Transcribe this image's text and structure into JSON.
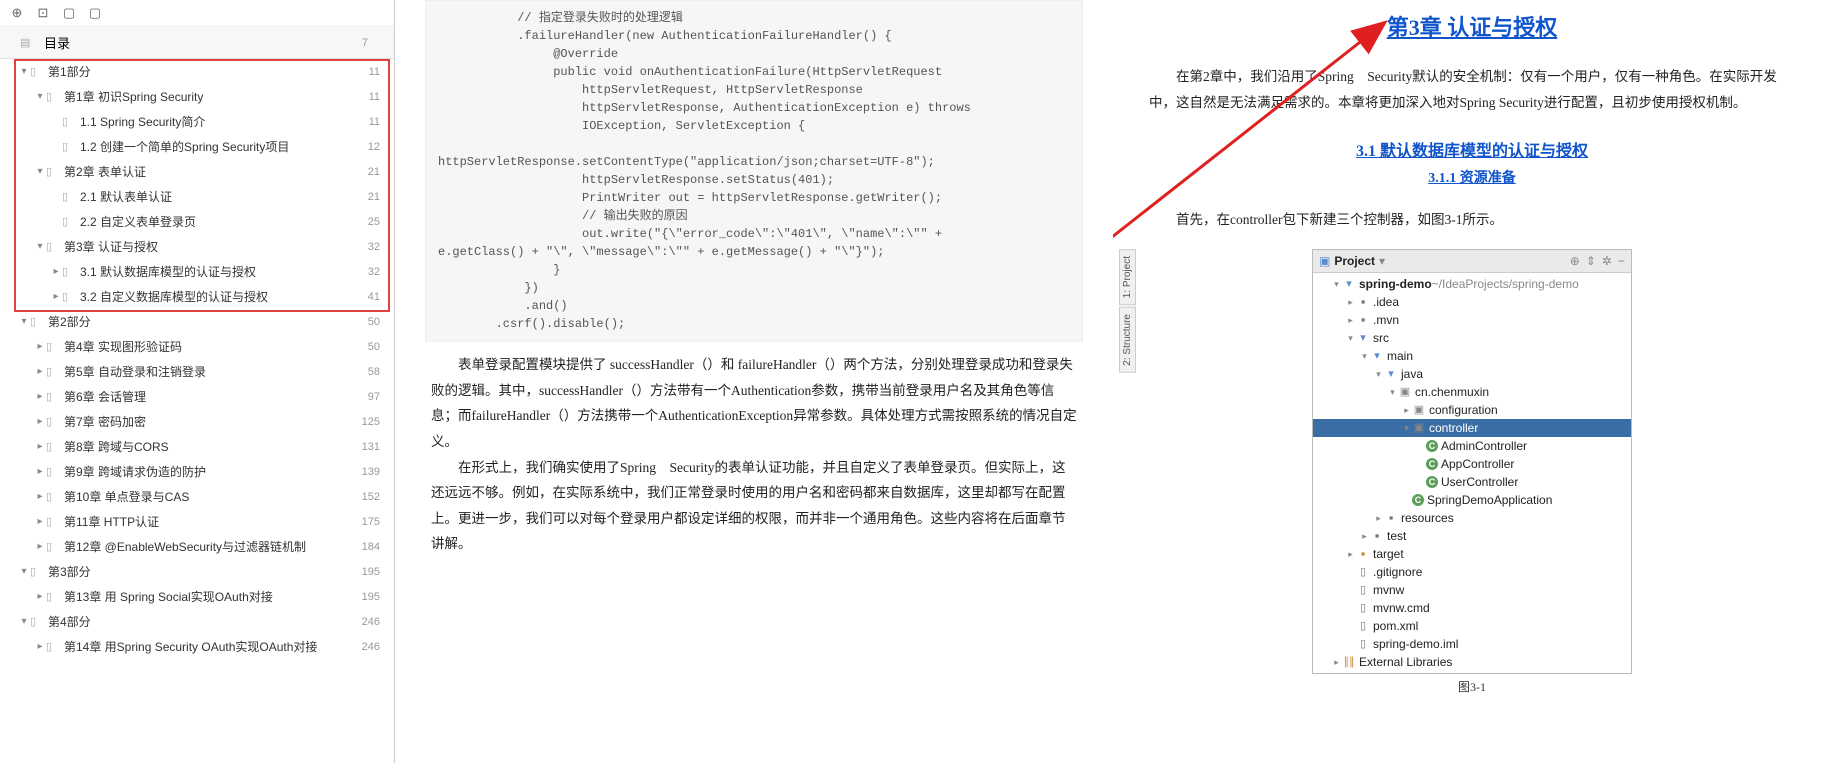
{
  "toolbar": {
    "btn1": "⊕",
    "btn2": "⊡",
    "btn3": "▢",
    "btn4": "▢"
  },
  "toc": {
    "header_label": "目录",
    "header_page": "7",
    "items": [
      {
        "level": 0,
        "exp": "▾",
        "label": "第1部分",
        "page": "11"
      },
      {
        "level": 1,
        "exp": "▾",
        "label": "第1章 初识Spring Security",
        "page": "11"
      },
      {
        "level": 2,
        "exp": "",
        "label": "1.1 Spring Security简介",
        "page": "11"
      },
      {
        "level": 2,
        "exp": "",
        "label": "1.2 创建一个简单的Spring Security项目",
        "page": "12"
      },
      {
        "level": 1,
        "exp": "▾",
        "label": "第2章 表单认证",
        "page": "21"
      },
      {
        "level": 2,
        "exp": "",
        "label": "2.1 默认表单认证",
        "page": "21"
      },
      {
        "level": 2,
        "exp": "",
        "label": "2.2 自定义表单登录页",
        "page": "25"
      },
      {
        "level": 1,
        "exp": "▾",
        "label": "第3章 认证与授权",
        "page": "32"
      },
      {
        "level": 2,
        "exp": "▸",
        "label": "3.1 默认数据库模型的认证与授权",
        "page": "32"
      },
      {
        "level": 2,
        "exp": "▸",
        "label": "3.2 自定义数据库模型的认证与授权",
        "page": "41"
      },
      {
        "level": 0,
        "exp": "▾",
        "label": "第2部分",
        "page": "50"
      },
      {
        "level": 1,
        "exp": "▸",
        "label": "第4章 实现图形验证码",
        "page": "50"
      },
      {
        "level": 1,
        "exp": "▸",
        "label": "第5章 自动登录和注销登录",
        "page": "58"
      },
      {
        "level": 1,
        "exp": "▸",
        "label": "第6章 会话管理",
        "page": "97"
      },
      {
        "level": 1,
        "exp": "▸",
        "label": "第7章 密码加密",
        "page": "125"
      },
      {
        "level": 1,
        "exp": "▸",
        "label": "第8章 跨域与CORS",
        "page": "131"
      },
      {
        "level": 1,
        "exp": "▸",
        "label": "第9章 跨域请求伪造的防护",
        "page": "139"
      },
      {
        "level": 1,
        "exp": "▸",
        "label": "第10章 单点登录与CAS",
        "page": "152"
      },
      {
        "level": 1,
        "exp": "▸",
        "label": "第11章 HTTP认证",
        "page": "175"
      },
      {
        "level": 1,
        "exp": "▸",
        "label": "第12章 @EnableWebSecurity与过滤器链机制",
        "page": "184"
      },
      {
        "level": 0,
        "exp": "▾",
        "label": "第3部分",
        "page": "195"
      },
      {
        "level": 1,
        "exp": "▸",
        "label": "第13章 用 Spring Social实现OAuth对接",
        "page": "195"
      },
      {
        "level": 0,
        "exp": "▾",
        "label": "第4部分",
        "page": "246"
      },
      {
        "level": 1,
        "exp": "▸",
        "label": "第14章 用Spring Security OAuth实现OAuth对接",
        "page": "246"
      }
    ]
  },
  "page_left": {
    "code": "           // 指定登录失败时的处理逻辑\n           .failureHandler(new AuthenticationFailureHandler() {\n                @Override\n                public void onAuthenticationFailure(HttpServletRequest\n                    httpServletRequest, HttpServletResponse\n                    httpServletResponse, AuthenticationException e) throws\n                    IOException, ServletException {\n\nhttpServletResponse.setContentType(\"application/json;charset=UTF-8\");\n                    httpServletResponse.setStatus(401);\n                    PrintWriter out = httpServletResponse.getWriter();\n                    // 输出失败的原因\n                    out.write(\"{\\\"error_code\\\":\\\"401\\\", \\\"name\\\":\\\"\" +\ne.getClass() + \"\\\", \\\"message\\\":\\\"\" + e.getMessage() + \"\\\"}\");\n                }\n            })\n            .and()\n        .csrf().disable();",
    "para1": "表单登录配置模块提供了 successHandler（）和 failureHandler（）两个方法，分别处理登录成功和登录失败的逻辑。其中，successHandler（）方法带有一个Authentication参数，携带当前登录用户名及其角色等信息；而failureHandler（）方法携带一个AuthenticationException异常参数。具体处理方式需按照系统的情况自定义。",
    "para2": "在形式上，我们确实使用了Spring　Security的表单认证功能，并且自定义了表单登录页。但实际上，这还远远不够。例如，在实际系统中，我们正常登录时使用的用户名和密码都来自数据库，这里却都写在配置上。更进一步，我们可以对每个登录用户都设定详细的权限，而并非一个通用角色。这些内容将在后面章节讲解。"
  },
  "page_right": {
    "chapter_title": "第3章 认证与授权",
    "intro": "在第2章中，我们沿用了Spring　Security默认的安全机制：仅有一个用户，仅有一种角色。在实际开发中，这自然是无法满足需求的。本章将更加深入地对Spring Security进行配置，且初步使用授权机制。",
    "sec_title": "3.1 默认数据库模型的认证与授权",
    "subsec_title": "3.1.1 资源准备",
    "sec_text": "首先，在controller包下新建三个控制器，如图3-1所示。",
    "fig_caption": "图3-1",
    "project": {
      "tab1": "1: Project",
      "tab2": "2: Structure",
      "header": "Project",
      "root": "spring-demo",
      "root_path": "~/IdeaProjects/spring-demo",
      "nodes": [
        {
          "pad": 1,
          "exp": "▾",
          "icon": "folder-open",
          "label": "spring-demo",
          "extra": " ~/IdeaProjects/spring-demo",
          "bold": true
        },
        {
          "pad": 2,
          "exp": "▸",
          "icon": "folder",
          "label": ".idea"
        },
        {
          "pad": 2,
          "exp": "▸",
          "icon": "folder",
          "label": ".mvn"
        },
        {
          "pad": 2,
          "exp": "▾",
          "icon": "folder-open",
          "label": "src"
        },
        {
          "pad": 3,
          "exp": "▾",
          "icon": "folder-open",
          "label": "main"
        },
        {
          "pad": 4,
          "exp": "▾",
          "icon": "folder-open",
          "label": "java"
        },
        {
          "pad": 5,
          "exp": "▾",
          "icon": "pkg",
          "label": "cn.chenmuxin"
        },
        {
          "pad": 6,
          "exp": "▸",
          "icon": "pkg",
          "label": "configuration"
        },
        {
          "pad": 6,
          "exp": "▾",
          "icon": "pkg",
          "label": "controller",
          "selected": true
        },
        {
          "pad": 7,
          "exp": "",
          "icon": "cls",
          "label": "AdminController"
        },
        {
          "pad": 7,
          "exp": "",
          "icon": "cls",
          "label": "AppController"
        },
        {
          "pad": 7,
          "exp": "",
          "icon": "cls",
          "label": "UserController"
        },
        {
          "pad": 6,
          "exp": "",
          "icon": "cls",
          "label": "SpringDemoApplication"
        },
        {
          "pad": 4,
          "exp": "▸",
          "icon": "folder",
          "label": "resources"
        },
        {
          "pad": 3,
          "exp": "▸",
          "icon": "folder",
          "label": "test"
        },
        {
          "pad": 2,
          "exp": "▸",
          "icon": "folder-orange",
          "label": "target"
        },
        {
          "pad": 2,
          "exp": "",
          "icon": "file",
          "label": ".gitignore"
        },
        {
          "pad": 2,
          "exp": "",
          "icon": "file",
          "label": "mvnw"
        },
        {
          "pad": 2,
          "exp": "",
          "icon": "file",
          "label": "mvnw.cmd"
        },
        {
          "pad": 2,
          "exp": "",
          "icon": "file",
          "label": "pom.xml"
        },
        {
          "pad": 2,
          "exp": "",
          "icon": "file",
          "label": "spring-demo.iml"
        },
        {
          "pad": 1,
          "exp": "▸",
          "icon": "libs",
          "label": "External Libraries"
        }
      ]
    }
  }
}
